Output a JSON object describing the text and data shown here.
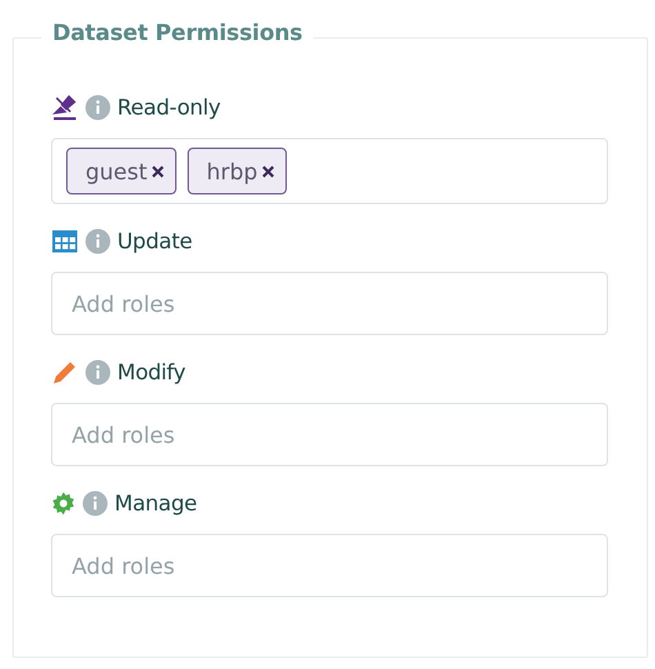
{
  "section": {
    "title": "Dataset Permissions"
  },
  "permissions": [
    {
      "kind": "read",
      "label": "Read-only",
      "roles": [
        "guest",
        "hrbp"
      ]
    },
    {
      "kind": "update",
      "label": "Update",
      "placeholder": "Add roles"
    },
    {
      "kind": "modify",
      "label": "Modify",
      "placeholder": "Add roles"
    },
    {
      "kind": "manage",
      "label": "Manage",
      "placeholder": "Add roles"
    }
  ]
}
